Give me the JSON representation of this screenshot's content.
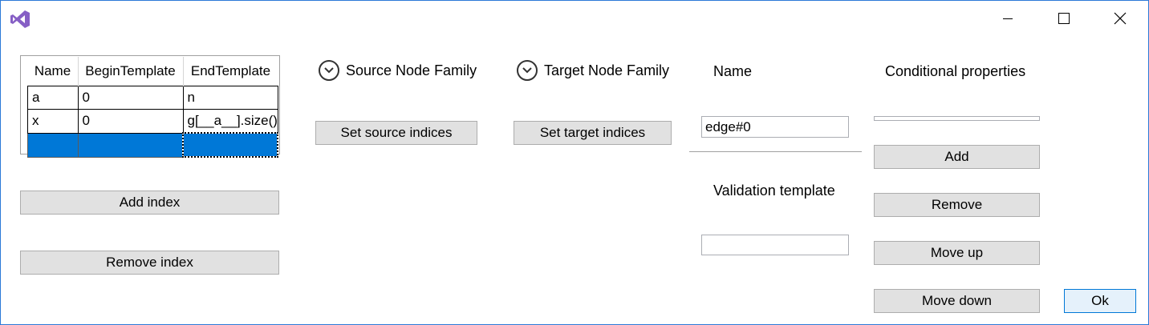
{
  "window": {
    "controls": {
      "minimize_icon": "minimize-icon",
      "maximize_icon": "maximize-icon",
      "close_icon": "close-icon"
    }
  },
  "indices_grid": {
    "columns": [
      "Name",
      "BeginTemplate",
      "EndTemplate"
    ],
    "rows": [
      [
        "a",
        "0",
        "n"
      ],
      [
        "x",
        "0",
        "g[__a__].size()"
      ],
      [
        "",
        "",
        ""
      ]
    ],
    "selected_row": 2
  },
  "buttons": {
    "add_index": "Add index",
    "remove_index": "Remove index",
    "set_source_indices": "Set source indices",
    "set_target_indices": "Set target indices",
    "add": "Add",
    "remove": "Remove",
    "move_up": "Move up",
    "move_down": "Move down",
    "ok": "Ok"
  },
  "source_expander": {
    "label": "Source Node Family",
    "icon": "chevron-down-icon"
  },
  "target_expander": {
    "label": "Target Node Family",
    "icon": "chevron-down-icon"
  },
  "name": {
    "label": "Name",
    "value": "edge#0"
  },
  "validation": {
    "label": "Validation template",
    "value": ""
  },
  "conditional": {
    "label": "Conditional properties",
    "items": []
  },
  "colors": {
    "accent": "#0078d7",
    "button_bg": "#e1e1e1",
    "button_border": "#adadad",
    "window_border": "#2b79d8",
    "logo": "#865fc5"
  }
}
